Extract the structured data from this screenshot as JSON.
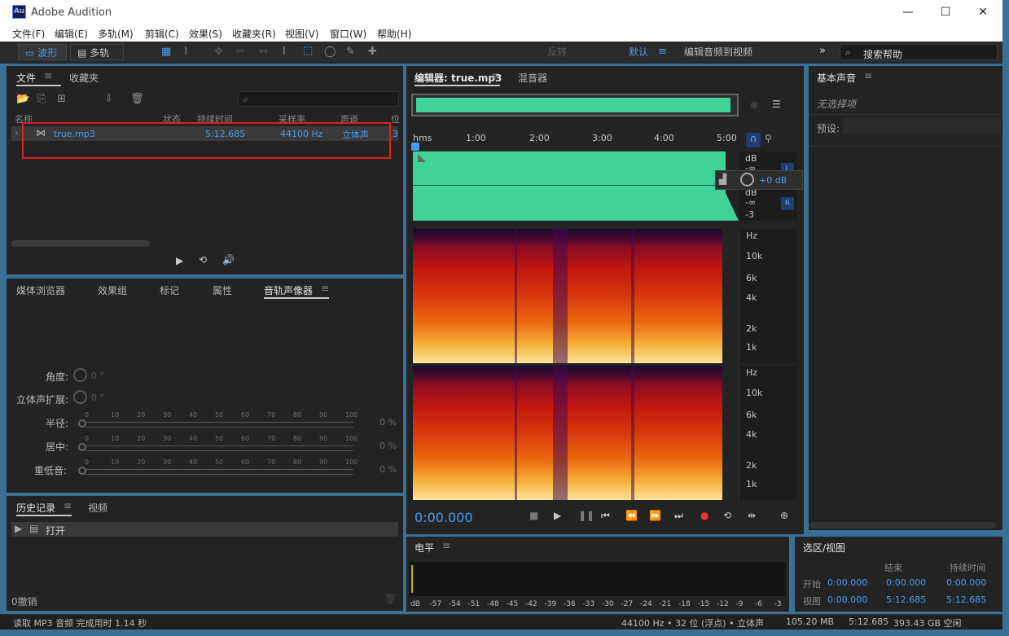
{
  "window": {
    "title": "Adobe Audition",
    "app_icon": "Au",
    "min": "—",
    "max": "☐",
    "close": "✕"
  },
  "menu": [
    "文件(F)",
    "编辑(E)",
    "多轨(M)",
    "剪辑(C)",
    "效果(S)",
    "收藏夹(R)",
    "视图(V)",
    "窗口(W)",
    "帮助(H)"
  ],
  "toolbar": {
    "waveform": "波形",
    "multitrack": "多轨",
    "reverse": "反转",
    "workspace_default": "默认",
    "workspace_video": "编辑音频到视频",
    "search_placeholder": "搜索帮助"
  },
  "files_panel": {
    "tabs": [
      "文件",
      "收藏夹"
    ],
    "columns": [
      "名称",
      "状态",
      "持续时间",
      "采样率",
      "声道",
      "位"
    ],
    "rows": [
      {
        "name": "true.mp3",
        "duration": "5:12.685",
        "sample_rate": "44100 Hz",
        "channels": "立体声",
        "bits": "3"
      }
    ]
  },
  "lower_tabs": [
    "媒体浏览器",
    "效果组",
    "标记",
    "属性",
    "音轨声像器"
  ],
  "panner": {
    "angle_label": "角度:",
    "angle_value": "0 °",
    "width_label": "立体声扩展:",
    "width_value": "0 °",
    "radius_label": "半径:",
    "center_label": "居中:",
    "lfe_label": "重低音:",
    "percent": "0 %",
    "scale": [
      "0",
      "10",
      "20",
      "30",
      "40",
      "50",
      "60",
      "70",
      "80",
      "90",
      "100"
    ]
  },
  "history": {
    "tabs": [
      "历史记录",
      "视频"
    ],
    "items": [
      "打开"
    ],
    "undo": "0撤销"
  },
  "editor": {
    "tab": "编辑器: true.mp3",
    "mixer_tab": "混音器",
    "ruler": [
      "hms",
      "1:00",
      "2:00",
      "3:00",
      "4:00",
      "5:00"
    ],
    "db_labels": [
      "dB",
      "-∞",
      "-3",
      "dB",
      "-∞",
      "-3"
    ],
    "gain": "+0 dB",
    "channel_l": "L",
    "channel_r": "R",
    "hz_labels": [
      "Hz",
      "10k",
      "6k",
      "4k",
      "2k",
      "1k"
    ],
    "time": "0:00.000"
  },
  "levels": {
    "title": "电平",
    "ticks": [
      "dB",
      "-57",
      "-54",
      "-51",
      "-48",
      "-45",
      "-42",
      "-39",
      "-36",
      "-33",
      "-30",
      "-27",
      "-24",
      "-21",
      "-18",
      "-15",
      "-12",
      "-9",
      "-6",
      "-3"
    ]
  },
  "essential_sound": {
    "title": "基本声音",
    "no_selection": "无选择项",
    "preset": "预设:"
  },
  "selection_view": {
    "title": "选区/视图",
    "col_end": "结束",
    "col_duration": "持续时间",
    "row1": "开始",
    "row2": "视图",
    "start1": "0:00.000",
    "end1": "0:00.000",
    "dur1": "0:00.000",
    "start2": "0:00.000",
    "end2": "5:12.685",
    "dur2": "5:12.685"
  },
  "status": {
    "left": "读取 MP3 音频 完成用时 1.14 秒",
    "rate": "44100 Hz • 32 位 (浮点) • 立体声",
    "size": "105.20 MB",
    "duration": "5:12.685",
    "free": "393.43 GB 空闲"
  },
  "colors": {
    "waveform": "#3fd39a",
    "accent": "#4a9bf0",
    "highlight_box": "#e02020"
  }
}
